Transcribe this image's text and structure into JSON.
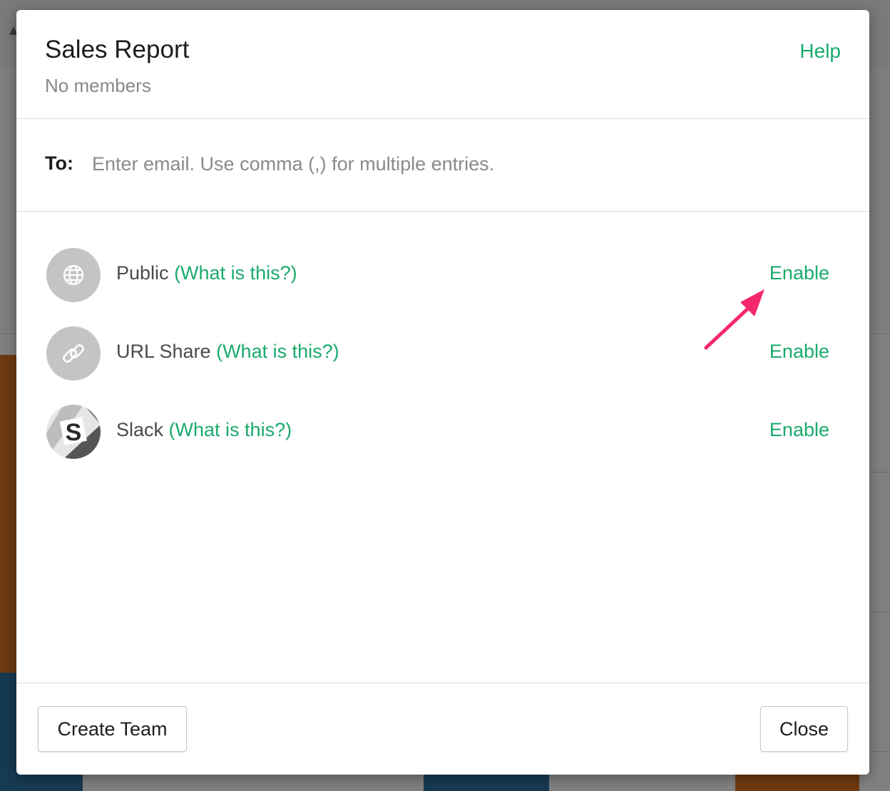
{
  "dialog": {
    "title": "Sales Report",
    "subtitle": "No members",
    "help_label": "Help"
  },
  "recipients": {
    "label": "To:",
    "placeholder": "Enter email. Use comma (,) for multiple entries.",
    "value": ""
  },
  "sharing_options": [
    {
      "name": "Public",
      "info_label": "(What is this?)",
      "action_label": "Enable",
      "icon": "globe-icon"
    },
    {
      "name": "URL Share",
      "info_label": "(What is this?)",
      "action_label": "Enable",
      "icon": "link-icon"
    },
    {
      "name": "Slack",
      "info_label": "(What is this?)",
      "action_label": "Enable",
      "icon": "slack-icon"
    }
  ],
  "footer": {
    "create_team_label": "Create Team",
    "close_label": "Close"
  },
  "colors": {
    "accent": "#1aaa6d",
    "annotation_arrow": "#f5286e",
    "overlay": "#7b7b7b"
  }
}
